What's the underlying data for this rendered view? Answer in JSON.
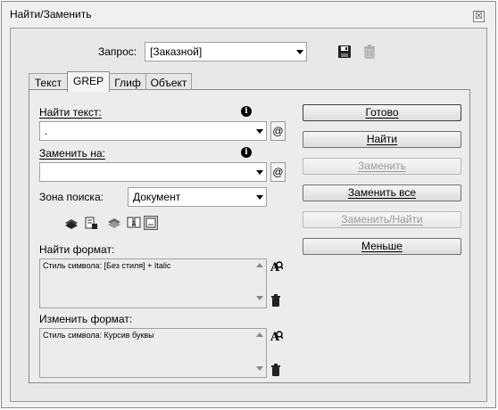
{
  "window": {
    "title": "Найти/Заменить",
    "close_glyph": "☒"
  },
  "query": {
    "label": "Запрос:",
    "value": "[Заказной]",
    "save_icon": "save-icon",
    "delete_icon": "trash-icon"
  },
  "tabs": [
    {
      "label": "Текст"
    },
    {
      "label": "GREP",
      "active": true
    },
    {
      "label": "Глиф"
    },
    {
      "label": "Объект"
    }
  ],
  "find": {
    "label": "Найти текст:",
    "value": ".",
    "special_glyph": "@"
  },
  "replace": {
    "label": "Заменить на:",
    "value": "",
    "special_glyph": "@"
  },
  "search_zone": {
    "label": "Зона поиска:",
    "value": "Документ"
  },
  "find_format": {
    "label": "Найти формат:",
    "value": "Стиль символа: [Без стиля] + Italic"
  },
  "change_format": {
    "label": "Изменить формат:",
    "value": "Стиль символа: Курсив буквы"
  },
  "buttons": {
    "done": "Готово",
    "find": "Найти",
    "replace": "Заменить",
    "replace_all": "Заменить все",
    "replace_find": "Заменить/Найти",
    "less": "Меньше"
  },
  "colors": {
    "dialog_bg": "#f0f0f0",
    "disabled_text": "#9c9c9c"
  }
}
